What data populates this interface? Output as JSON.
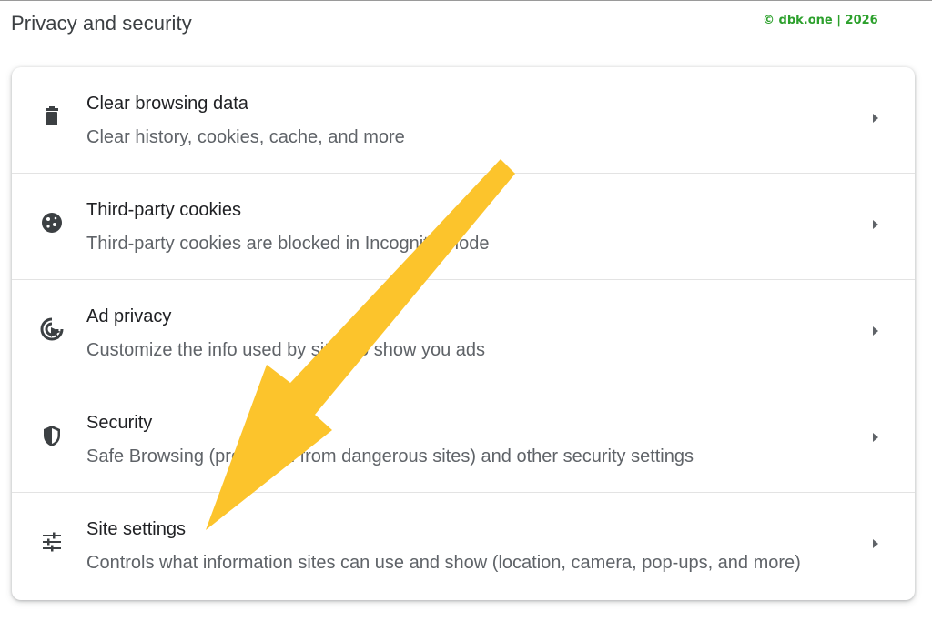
{
  "header": {
    "title": "Privacy and security",
    "watermark": "© dbk.one | 2026"
  },
  "items": [
    {
      "title": "Clear browsing data",
      "subtitle": "Clear history, cookies, cache, and more",
      "icon": "trash-icon"
    },
    {
      "title": "Third-party cookies",
      "subtitle": "Third-party cookies are blocked in Incognito mode",
      "icon": "cookie-icon"
    },
    {
      "title": "Ad privacy",
      "subtitle": "Customize the info used by sites to show you ads",
      "icon": "ad-privacy-icon"
    },
    {
      "title": "Security",
      "subtitle": "Safe Browsing (protection from dangerous sites) and other security settings",
      "icon": "shield-icon"
    },
    {
      "title": "Site settings",
      "subtitle": "Controls what information sites can use and show (location, camera, pop-ups, and more)",
      "icon": "tune-sliders-icon"
    }
  ],
  "colors": {
    "annotation_arrow": "#fcc42c",
    "watermark": "#2ca02c",
    "title_text": "#202124",
    "subtitle_text": "#5f6368",
    "icon": "#3c4043"
  }
}
